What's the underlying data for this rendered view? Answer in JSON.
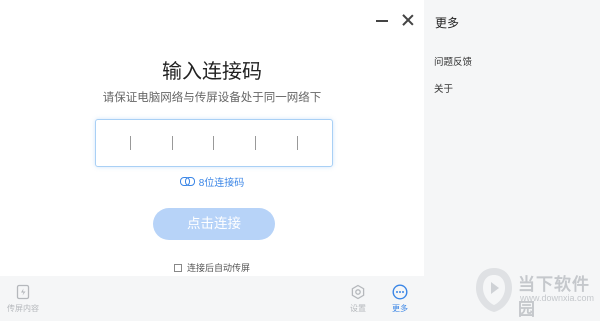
{
  "window": {
    "minimize_label": "—",
    "close_label": "×"
  },
  "main": {
    "title": "输入连接码",
    "subtitle": "请保证电脑网络与传屏设备处于同一网络下",
    "code_slots": 6,
    "code_type_label": "8位连接码",
    "connect_button": "点击连接",
    "auto_cast_label": "连接后自动传屏",
    "auto_cast_checked": false
  },
  "bottom_bar": {
    "cast_label": "传屏内容",
    "settings_label": "设置",
    "more_label": "更多"
  },
  "side_panel": {
    "title": "更多",
    "items": [
      {
        "label": "问题反馈"
      },
      {
        "label": "关于"
      }
    ]
  },
  "watermark": {
    "name": "当下软件园",
    "url": "www.downxia.com"
  },
  "colors": {
    "accent": "#3b86e6",
    "button_disabled": "#b7d3f8",
    "panel_bg": "#f5f6f7"
  },
  "icons": {
    "cast": "cast-screen-icon",
    "settings": "gear-icon",
    "more": "more-dots-icon",
    "link": "link-icon",
    "minimize": "minimize-icon",
    "close": "close-icon"
  }
}
